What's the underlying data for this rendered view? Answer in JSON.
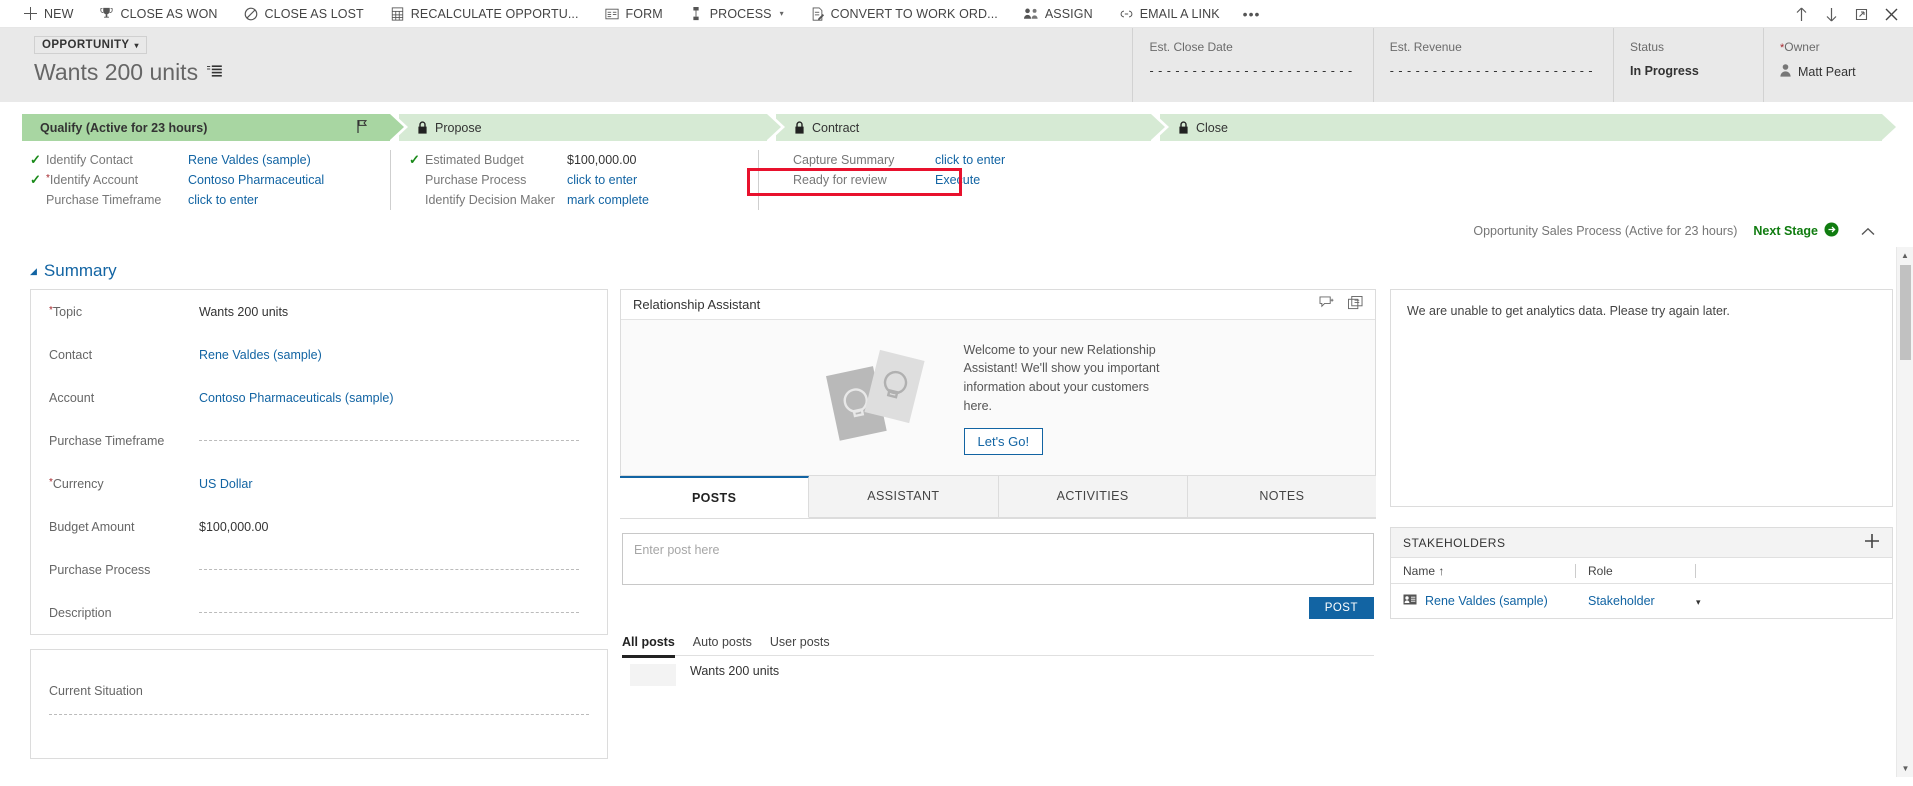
{
  "commandbar": {
    "buttons": [
      {
        "label": "NEW",
        "icon": "plus-icon"
      },
      {
        "label": "CLOSE AS WON",
        "icon": "trophy-icon"
      },
      {
        "label": "CLOSE AS LOST",
        "icon": "prohibited-icon"
      },
      {
        "label": "RECALCULATE OPPORTU...",
        "icon": "calculator-icon"
      },
      {
        "label": "FORM",
        "icon": "form-icon"
      },
      {
        "label": "PROCESS",
        "icon": "process-icon",
        "caret": "▾"
      },
      {
        "label": "CONVERT TO WORK ORD...",
        "icon": "work-order-icon"
      },
      {
        "label": "ASSIGN",
        "icon": "assign-users-icon"
      },
      {
        "label": "EMAIL A LINK",
        "icon": "link-icon"
      }
    ],
    "overflow": "•••",
    "right_icons": [
      "up-arrow-icon",
      "down-arrow-icon",
      "popout-icon",
      "close-icon"
    ]
  },
  "header": {
    "entity_label": "OPPORTUNITY",
    "entity_caret": "▾",
    "record_title": "Wants 200 units",
    "fields": [
      {
        "label": "Est. Close Date",
        "value": "",
        "empty": true,
        "required": false,
        "bold": false,
        "link": false
      },
      {
        "label": "Est. Revenue",
        "value": "",
        "empty": true,
        "required": false,
        "bold": false,
        "link": false
      },
      {
        "label": "Status",
        "value": "In Progress",
        "empty": false,
        "required": false,
        "bold": true,
        "link": false
      },
      {
        "label": "Owner",
        "value": "Matt Peart",
        "empty": false,
        "required": true,
        "bold": false,
        "link": true
      }
    ]
  },
  "process": {
    "stages": [
      {
        "label": "Qualify (Active for 23 hours)",
        "active": true,
        "locked": false
      },
      {
        "label": "Propose",
        "active": false,
        "locked": true
      },
      {
        "label": "Contract",
        "active": false,
        "locked": true
      },
      {
        "label": "Close",
        "active": false,
        "locked": true
      }
    ],
    "columns": [
      {
        "rows": [
          {
            "checked": true,
            "required": false,
            "label": "Identify Contact",
            "value": "Rene Valdes (sample)",
            "link": true
          },
          {
            "checked": true,
            "required": true,
            "label": "Identify Account",
            "value": "Contoso Pharmaceutical",
            "link": true
          },
          {
            "checked": false,
            "required": false,
            "label": "Purchase Timeframe",
            "value": "click to enter",
            "link": true
          }
        ]
      },
      {
        "rows": [
          {
            "checked": true,
            "required": false,
            "label": "Estimated Budget",
            "value": "$100,000.00",
            "link": false
          },
          {
            "checked": false,
            "required": false,
            "label": "Purchase Process",
            "value": "click to enter",
            "link": true
          },
          {
            "checked": false,
            "required": false,
            "label": "Identify Decision Maker",
            "value": "mark complete",
            "link": true
          }
        ]
      },
      {
        "rows": [
          {
            "checked": false,
            "required": false,
            "label": "Capture Summary",
            "value": "click to enter",
            "link": true
          },
          {
            "checked": false,
            "required": false,
            "label": "Ready for review",
            "value": "Execute",
            "link": true
          }
        ]
      }
    ],
    "footer_name": "Opportunity Sales Process (Active for 23 hours)",
    "next_stage_label": "Next Stage",
    "collapse_icon": "chevron-up-icon",
    "highlight_color": "#e8112d"
  },
  "summary": {
    "section_title": "Summary",
    "fields": [
      {
        "label": "Topic",
        "value": "Wants 200 units",
        "required": true,
        "link": false,
        "empty": false
      },
      {
        "label": "Contact",
        "value": "Rene Valdes (sample)",
        "required": false,
        "link": true,
        "empty": false
      },
      {
        "label": "Account",
        "value": "Contoso Pharmaceuticals (sample)",
        "required": false,
        "link": true,
        "empty": false
      },
      {
        "label": "Purchase Timeframe",
        "value": "",
        "required": false,
        "link": false,
        "empty": true
      },
      {
        "label": "Currency",
        "value": "US Dollar",
        "required": true,
        "link": true,
        "empty": false
      },
      {
        "label": "Budget Amount",
        "value": "$100,000.00",
        "required": false,
        "link": false,
        "empty": false
      },
      {
        "label": "Purchase Process",
        "value": "",
        "required": false,
        "link": false,
        "empty": true
      },
      {
        "label": "Description",
        "value": "",
        "required": false,
        "link": false,
        "empty": true
      }
    ],
    "current_situation_label": "Current Situation"
  },
  "assistant": {
    "title": "Relationship Assistant",
    "welcome_text": "Welcome to your new Relationship Assistant! We'll show you important information about your customers here.",
    "cta_label": "Let's Go!",
    "header_icons": [
      "feedback-icon",
      "cards-icon"
    ]
  },
  "social": {
    "tabs": [
      {
        "label": "POSTS",
        "active": true
      },
      {
        "label": "ASSISTANT",
        "active": false
      },
      {
        "label": "ACTIVITIES",
        "active": false
      },
      {
        "label": "NOTES",
        "active": false
      }
    ],
    "post_placeholder": "Enter post here",
    "post_button": "POST",
    "filters": [
      {
        "label": "All posts",
        "active": true
      },
      {
        "label": "Auto posts",
        "active": false
      },
      {
        "label": "User posts",
        "active": false
      }
    ],
    "posts": [
      {
        "title": "Wants 200 units"
      }
    ]
  },
  "analytics": {
    "message": "We are unable to get analytics data. Please try again later."
  },
  "stakeholders": {
    "title": "STAKEHOLDERS",
    "add_icon": "plus-icon",
    "columns": [
      "Name ↑",
      "Role",
      ""
    ],
    "rows": [
      {
        "name": "Rene Valdes (sample)",
        "role": "Stakeholder",
        "caret": "▾"
      }
    ]
  }
}
